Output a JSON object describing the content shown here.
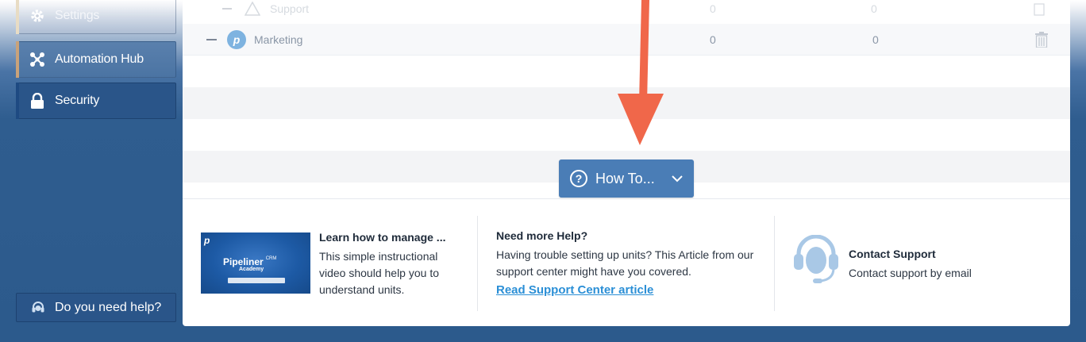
{
  "sidebar": {
    "items": [
      {
        "label": "Settings",
        "icon": "gear-icon"
      },
      {
        "label": "Automation Hub",
        "icon": "network-icon"
      },
      {
        "label": "Security",
        "icon": "lock-icon"
      }
    ],
    "help_label": "Do you need help?"
  },
  "table": {
    "rows": [
      {
        "name": "Support",
        "col1": "0",
        "col2": "0"
      },
      {
        "name": "Marketing",
        "col1": "0",
        "col2": "0"
      }
    ]
  },
  "howto": {
    "label": "How To..."
  },
  "help": {
    "video": {
      "thumb_brand": "Pipeliner",
      "thumb_crm": "CRM",
      "thumb_academy": "Academy",
      "title": "Learn how to manage ...",
      "text": "This simple instructional video should help you to understand units."
    },
    "article": {
      "title": "Need more Help?",
      "text": "Having trouble setting up units? This Article from our support center might have you covered.",
      "link": "Read Support Center article"
    },
    "contact": {
      "title": "Contact Support",
      "text": "Contact support by email"
    }
  },
  "colors": {
    "accent": "#4a7db6",
    "link": "#2b8fd6",
    "sidebar_active": "#2a5589",
    "arrow": "#f0674a"
  }
}
